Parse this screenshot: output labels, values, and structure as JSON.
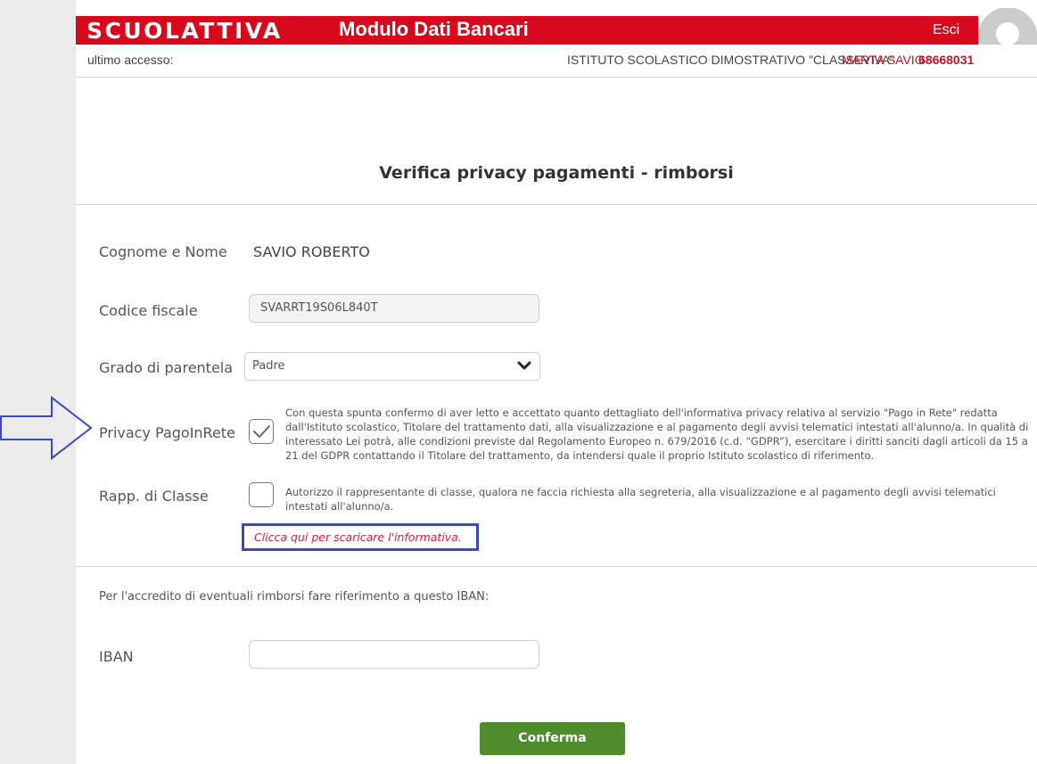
{
  "header": {
    "brand": "SCUOLATTIVA",
    "module_title": "Modulo Dati Bancari",
    "logout_label": "Esci",
    "last_access_label": "ultimo accesso:",
    "institute": "ISTITUTO SCOLASTICO DIMOSTRATIVO \"CLASSEVIVA\"",
    "user_name": "MARTA SAVIO",
    "user_code": "68668031",
    "brand_color": "#d8081d"
  },
  "page": {
    "title": "Verifica privacy pagamenti - rimborsi"
  },
  "form": {
    "name_label": "Cognome e Nome",
    "name_value": "SAVIO ROBERTO",
    "fiscal_code_label": "Codice fiscale",
    "fiscal_code_value": "SVARRT19S06L840T",
    "kinship_label": "Grado di parentela",
    "kinship_selected": "Padre",
    "privacy_label": "Privacy PagoInRete",
    "privacy_checked": true,
    "privacy_text": "Con questa spunta confermo di aver letto e accettato quanto dettagliato dell'informativa privacy relativa al servizio \"Pago in Rete\" redatta dall'Istituto scolastico, Titolare del trattamento dati, alla visualizzazione e al pagamento degli avvisi telematici intestati all'alunno/a. In qualità di interessato Lei potrà, alle condizioni previste dal Regolamento Europeo n. 679/2016 (c.d. “GDPR”), esercitare i diritti sanciti dagli articoli da 15 a 21 del GDPR contattando il Titolare del trattamento, da intendersi quale il proprio Istituto scolastico di riferimento.",
    "class_rep_label": "Rapp. di Classe",
    "class_rep_checked": false,
    "class_rep_text": "Autorizzo il rappresentante di classe, qualora ne faccia richiesta alla segreteria, alla visualizzazione e al pagamento degli avvisi telematici intestati all'alunno/a.",
    "download_link": "Clicca qui per scaricare l'informativa.",
    "iban_note": "Per l'accredito di eventuali rimborsi fare riferimento a questo IBAN:",
    "iban_label": "IBAN",
    "iban_value": "",
    "confirm_label": "Conferma"
  },
  "icons": {
    "avatar": "user-avatar-icon",
    "chevron": "chevron-down-icon",
    "check": "check-icon",
    "arrow": "arrow-right-outline-icon"
  },
  "colors": {
    "accent_red": "#d8081d",
    "button_green": "#4e8c2c",
    "annotation_blue": "#3949c9"
  }
}
